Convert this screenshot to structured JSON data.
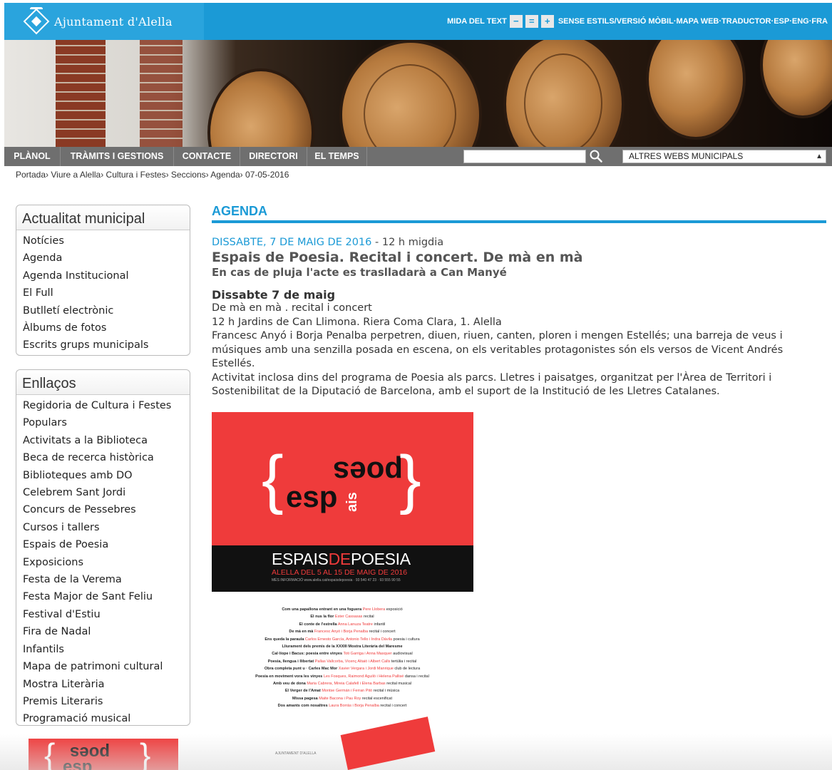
{
  "header": {
    "logo_text": "Ajuntament d'Alella",
    "text_size_label": "MIDA DEL TEXT",
    "size_decrease": "−",
    "size_reset": "=",
    "size_increase": "+",
    "links": [
      "SENSE ESTILS/VERSIÓ MÒBIL",
      "MAPA WEB",
      "TRADUCTOR",
      "ESP",
      "ENG",
      "FRA"
    ],
    "link_separator": " · ",
    "accent_color": "#1b9ad6"
  },
  "nav": {
    "items": [
      "PLÀNOL",
      "TRÀMITS I GESTIONS",
      "CONTACTE",
      "DIRECTORI",
      "EL TEMPS"
    ],
    "search_placeholder": "",
    "search_icon": "search-icon",
    "select_value": "ALTRES WEBS MUNICIPALS"
  },
  "breadcrumb": [
    "Portada",
    "Viure a Alella",
    "Cultura i Festes",
    "Seccions",
    "Agenda",
    "07-05-2016"
  ],
  "sidebar": {
    "actualitat": {
      "title": "Actualitat municipal",
      "items": [
        "Notícies",
        "Agenda",
        "Agenda Institucional",
        "El Full",
        "Butlletí electrònic",
        "Àlbums de fotos",
        "Escrits grups municipals"
      ]
    },
    "enllacos": {
      "title": "Enllaços",
      "items": [
        "Regidoria de Cultura i Festes Populars",
        "Activitats a la Biblioteca",
        "Beca de recerca històrica",
        "Biblioteques amb DO",
        "Celebrem Sant Jordi",
        "Concurs de Pessebres",
        "Cursos i tallers",
        "Espais de Poesia",
        "Exposicions",
        "Festa de la Verema",
        "Festa Major de Sant Feliu",
        "Festival d'Estiu",
        "Fira de Nadal",
        "Infantils",
        "Mapa de patrimoni cultural",
        "Mostra Literària",
        "Premis Literaris",
        "Programació musical"
      ]
    }
  },
  "main": {
    "section_title": "AGENDA",
    "event": {
      "date": "DISSABTE, 7 DE MAIG DE 2016",
      "date_sep": " - ",
      "time": "12 h migdia",
      "title": "Espais de Poesia. Recital i concert. De mà en mà",
      "subtitle": "En cas de pluja l'acte es traslladarà a Can Manyé",
      "day_heading": "Dissabte 7 de maig",
      "lines": [
        "De mà en mà . recital i concert",
        "12 h Jardins de Can Llimona. Riera Coma Clara, 1. Alella",
        "Francesc Anyó i Borja Penalba perpetren, diuen, riuen, canten, ploren i mengen Estellés; una barreja de veus i músiques amb una senzilla posada en escena, on els veritables protagonistes són els versos de Vicent Andrés Estellés.",
        "Activitat inclosa dins del programa de Poesia als parcs. Lletres i paisatges, organitzat per l'Àrea de Territori i Sostenibilitat de la Diputació de Barcelona, amb el suport de la Institució de les Lletres Catalanes."
      ]
    },
    "poster": {
      "word_top": "poes",
      "word_bottom": "esp",
      "word_side": "ais",
      "title_a": "ESPAIS",
      "title_b": "DE",
      "title_c": "POESIA",
      "subtitle": "ALELLA DEL 5 AL 15 DE MAIG DE 2016",
      "info": "MÉS INFORMACIÓ  www.alella.cat/espaisdepoesia · 93 540 47 23 · 93 555 90 55"
    },
    "programme": [
      {
        "t": "Com una papallona entrant en una foguera",
        "p": "Pere Llobera",
        "k": "exposició"
      },
      {
        "t": "El nus la flor",
        "p": "Ester Cassasas",
        "k": "recital"
      },
      {
        "t": "El conte de l'estrella",
        "p": "Anna Lanuza Teatre",
        "k": "infantil"
      },
      {
        "t": "De mà en mà",
        "p": "Francesc Anyó i Borja Penalba",
        "k": "recital i concert"
      },
      {
        "t": "Ens queda la paraula",
        "p": "Carlos Ernesto García, Antonio Tello i Indra Dávila",
        "k": "poesia i cultura"
      },
      {
        "t": "Lliurament dels premis de la XXXIII Mostra Literària del Maresme",
        "p": "",
        "k": ""
      },
      {
        "t": "Cal·líope i Bacus: poesia entre vinyes",
        "p": "Toti Garriga i Anna Masquer",
        "k": "audiovisual"
      },
      {
        "t": "Poesia, llengua i llibertat",
        "p": "Pallas Vallcorba, Vicenç Altaió i Albert Calls",
        "k": "tertúlia i recital"
      },
      {
        "t": "Obra completa punt u · Carles Mac Mor",
        "p": "Xavier Vergara i Jordi Manrique",
        "k": "club de lectura"
      },
      {
        "t": "Poesia en moviment vora les vinyes",
        "p": "Les Fosques, Raimond Aguiló i Helena Pallisé",
        "k": "dansa i recital"
      },
      {
        "t": "Amb veu de dona",
        "p": "Maria Cabrera, Mireia Calafell i Elena Barbas",
        "k": "recital musical"
      },
      {
        "t": "El Verger de l'Amat",
        "p": "Montse Germán i Ferran Pitó",
        "k": "recital i música"
      },
      {
        "t": "Missa pagesa",
        "p": "Maite Bacona i Pau Roy",
        "k": "recital escenificat"
      },
      {
        "t": "Dos amants com nosaltres",
        "p": "Laura Borràs i Borja Penalba",
        "k": "recital i concert"
      }
    ],
    "flyer_logo": "AJUNTAMENT D'ALELLA"
  }
}
